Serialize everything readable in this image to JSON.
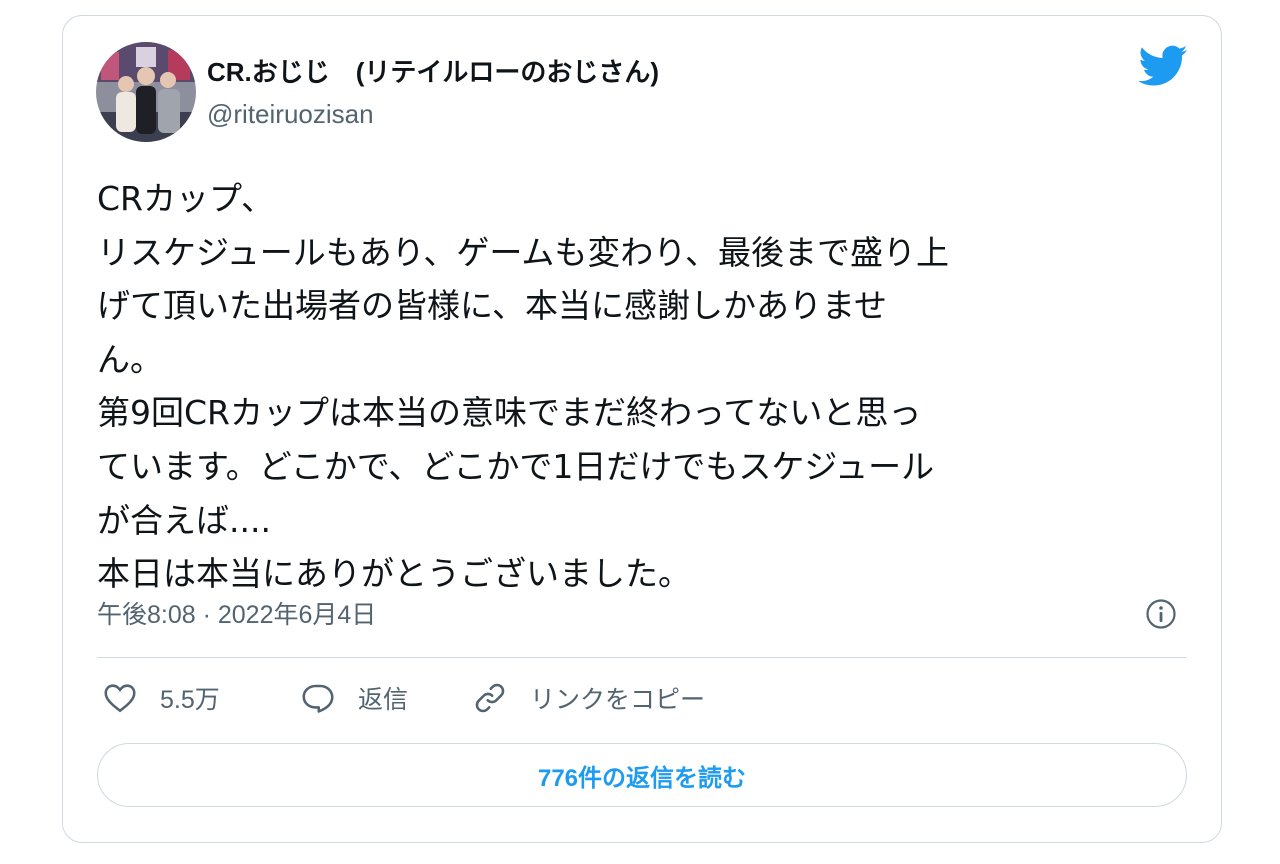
{
  "author": {
    "display_name": "CR.おじじ　(リテイルローのおじさん)",
    "handle": "@riteiruozisan",
    "avatar_icon": "user-avatar-photo"
  },
  "brand": {
    "icon": "twitter-bird-icon",
    "color": "#1d9bf0"
  },
  "tweet": {
    "lines": [
      "CRカップ、",
      "リスケジュールもあり、ゲームも変わり、最後まで盛り上",
      "げて頂いた出場者の皆様に、本当に感謝しかありませ",
      "ん。",
      "第9回CRカップは本当の意味でまだ終わってないと思っ",
      "ています。どこかで、どこかで1日だけでもスケジュール",
      "が合えば....",
      "本日は本当にありがとうございました。"
    ],
    "timestamp": "午後8:08 · 2022年6月4日"
  },
  "actions": {
    "like_count": "5.5万",
    "reply_label": "返信",
    "copy_link_label": "リンクをコピー"
  },
  "read_replies_label": "776件の返信を読む",
  "colors": {
    "secondary_text": "#536471",
    "accent": "#1d9bf0",
    "border": "#cfd9de"
  }
}
